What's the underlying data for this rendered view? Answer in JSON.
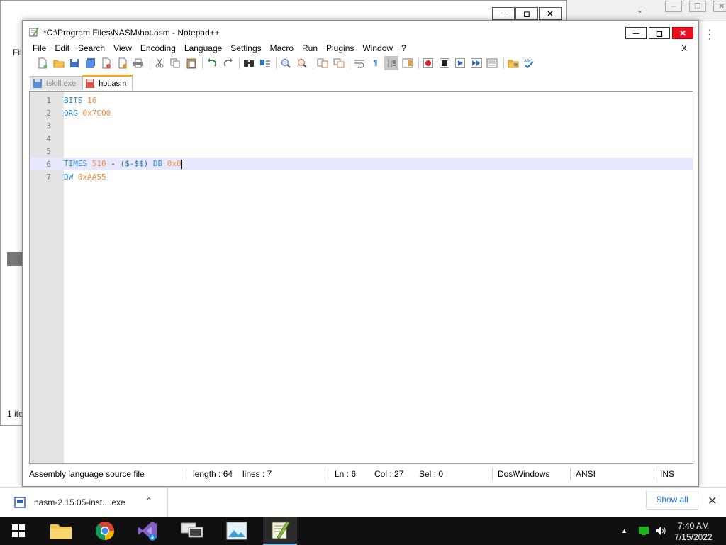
{
  "background_window": {
    "fragments": [
      "Fil",
      "1 ite"
    ]
  },
  "notepad": {
    "title": "*C:\\Program Files\\NASM\\hot.asm - Notepad++",
    "menu": [
      "File",
      "Edit",
      "Search",
      "View",
      "Encoding",
      "Language",
      "Settings",
      "Macro",
      "Run",
      "Plugins",
      "Window",
      "?"
    ],
    "doc_close": "X",
    "tabs": [
      {
        "label": "tskill.exe",
        "active": false
      },
      {
        "label": "hot.asm",
        "active": true
      }
    ],
    "line_numbers": [
      "1",
      "2",
      "3",
      "4",
      "5",
      "6",
      "7"
    ],
    "code": {
      "line1": {
        "kw": "BITS",
        "num": "16"
      },
      "line2": {
        "kw": "ORG",
        "num": "0x7C00"
      },
      "line6": {
        "kw": "TIMES",
        "num": "510",
        "op": " - ",
        "expr": "($-$$)",
        "kw2": "DB",
        "num2": "0x0"
      },
      "line7": {
        "kw": "DW",
        "num": "0xAA55"
      }
    },
    "current_line": 6,
    "status": {
      "file_type": "Assembly language source file",
      "length": "length : 64",
      "lines": "lines : 7",
      "ln": "Ln : 6",
      "col": "Col : 27",
      "sel": "Sel : 0",
      "eol": "Dos\\Windows",
      "encoding": "ANSI",
      "mode": "INS"
    },
    "toolbar_icons": [
      "new-file-icon",
      "open-file-icon",
      "save-icon",
      "save-all-icon",
      "close-icon",
      "close-all-icon",
      "print-icon",
      "cut-icon",
      "copy-icon",
      "paste-icon",
      "undo-icon",
      "redo-icon",
      "find-icon",
      "replace-icon",
      "zoom-in-icon",
      "zoom-out-icon",
      "sync-v-icon",
      "sync-h-icon",
      "word-wrap-icon",
      "show-all-chars-icon",
      "indent-guide-icon",
      "doc-map-icon",
      "record-macro-icon",
      "stop-record-icon",
      "play-macro-icon",
      "run-macro-multiple-icon",
      "save-macro-icon",
      "folder-workspace-icon",
      "spell-check-icon"
    ]
  },
  "download_bar": {
    "file_name": "nasm-2.15.05-inst....exe",
    "show_all": "Show all"
  },
  "taskbar": {
    "time": "7:40 AM",
    "date": "7/15/2022"
  },
  "colors": {
    "keyword": "#2a8fd6",
    "number": "#f08c38",
    "current_line": "#e8e8ff",
    "tab_accent": "#f6a623",
    "close_red": "#e81123",
    "taskbar": "#101010"
  }
}
